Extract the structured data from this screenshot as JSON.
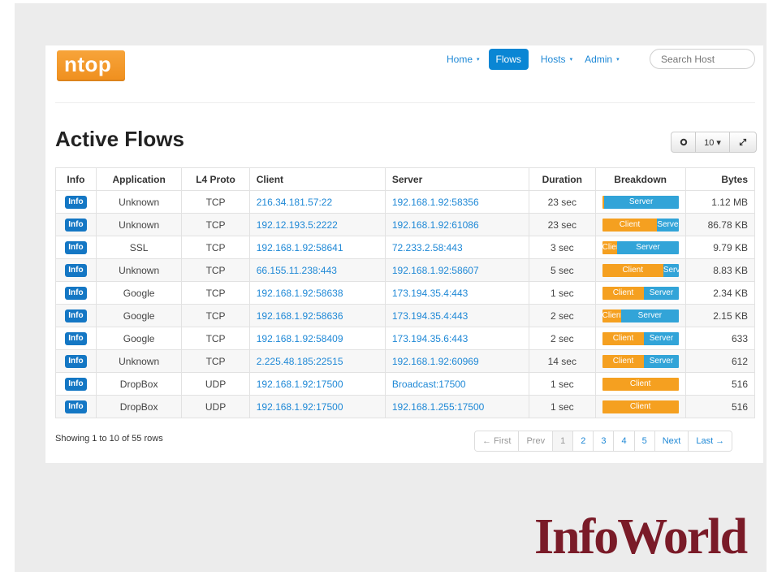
{
  "brand": {
    "logo_text": "ntop"
  },
  "nav": {
    "items": [
      {
        "label": "Home",
        "caret": "▾",
        "active": false
      },
      {
        "label": "Flows",
        "caret": "",
        "active": true
      },
      {
        "label": "Hosts",
        "caret": "▾",
        "active": false
      },
      {
        "label": "Admin",
        "caret": "▾",
        "active": false
      }
    ],
    "search_placeholder": "Search Host"
  },
  "page": {
    "title": "Active Flows"
  },
  "toolbar": {
    "gear_icon": "gear-icon",
    "page_size": "10 ▾",
    "expand_icon": "expand-icon"
  },
  "table": {
    "headers": {
      "info": "Info",
      "application": "Application",
      "l4proto": "L4 Proto",
      "client": "Client",
      "server": "Server",
      "duration": "Duration",
      "breakdown": "Breakdown",
      "bytes": "Bytes"
    },
    "rows": [
      {
        "info": "Info",
        "app": "Unknown",
        "proto": "TCP",
        "client": "216.34.181.57:22",
        "server": "192.168.1.92:58356",
        "duration": "23 sec",
        "client_pct": 2,
        "client_label": "",
        "server_label": "Server",
        "bytes": "1.12 MB"
      },
      {
        "info": "Info",
        "app": "Unknown",
        "proto": "TCP",
        "client": "192.12.193.5:2222",
        "server": "192.168.1.92:61086",
        "duration": "23 sec",
        "client_pct": 72,
        "client_label": "Client",
        "server_label": "Server",
        "bytes": "86.78 KB"
      },
      {
        "info": "Info",
        "app": "SSL",
        "proto": "TCP",
        "client": "192.168.1.92:58641",
        "server": "72.233.2.58:443",
        "duration": "3 sec",
        "client_pct": 20,
        "client_label": "Client",
        "server_label": "Server",
        "bytes": "9.79 KB"
      },
      {
        "info": "Info",
        "app": "Unknown",
        "proto": "TCP",
        "client": "66.155.11.238:443",
        "server": "192.168.1.92:58607",
        "duration": "5 sec",
        "client_pct": 80,
        "client_label": "Client",
        "server_label": "Server",
        "bytes": "8.83 KB"
      },
      {
        "info": "Info",
        "app": "Google",
        "proto": "TCP",
        "client": "192.168.1.92:58638",
        "server": "173.194.35.4:443",
        "duration": "1 sec",
        "client_pct": 55,
        "client_label": "Client",
        "server_label": "Server",
        "bytes": "2.34 KB"
      },
      {
        "info": "Info",
        "app": "Google",
        "proto": "TCP",
        "client": "192.168.1.92:58636",
        "server": "173.194.35.4:443",
        "duration": "2 sec",
        "client_pct": 25,
        "client_label": "Client",
        "server_label": "Server",
        "bytes": "2.15 KB"
      },
      {
        "info": "Info",
        "app": "Google",
        "proto": "TCP",
        "client": "192.168.1.92:58409",
        "server": "173.194.35.6:443",
        "duration": "2 sec",
        "client_pct": 55,
        "client_label": "Client",
        "server_label": "Server",
        "bytes": "633"
      },
      {
        "info": "Info",
        "app": "Unknown",
        "proto": "TCP",
        "client": "2.225.48.185:22515",
        "server": "192.168.1.92:60969",
        "duration": "14 sec",
        "client_pct": 55,
        "client_label": "Client",
        "server_label": "Server",
        "bytes": "612"
      },
      {
        "info": "Info",
        "app": "DropBox",
        "proto": "UDP",
        "client": "192.168.1.92:17500",
        "server": "Broadcast:17500",
        "duration": "1 sec",
        "client_pct": 100,
        "client_label": "Client",
        "server_label": "",
        "bytes": "516"
      },
      {
        "info": "Info",
        "app": "DropBox",
        "proto": "UDP",
        "client": "192.168.1.92:17500",
        "server": "192.168.1.255:17500",
        "duration": "1 sec",
        "client_pct": 100,
        "client_label": "Client",
        "server_label": "",
        "bytes": "516"
      }
    ]
  },
  "footer": {
    "showing": "Showing 1 to 10 of 55 rows",
    "pager": {
      "first": "← First",
      "prev": "Prev",
      "pages": [
        "1",
        "2",
        "3",
        "4",
        "5"
      ],
      "next": "Next",
      "last": "Last →"
    }
  },
  "watermark": {
    "text": "InfoWorld"
  },
  "colors": {
    "accent": "#0a86d4",
    "client": "#f5a020",
    "server": "#32a4d8",
    "badge": "#1477c4"
  }
}
